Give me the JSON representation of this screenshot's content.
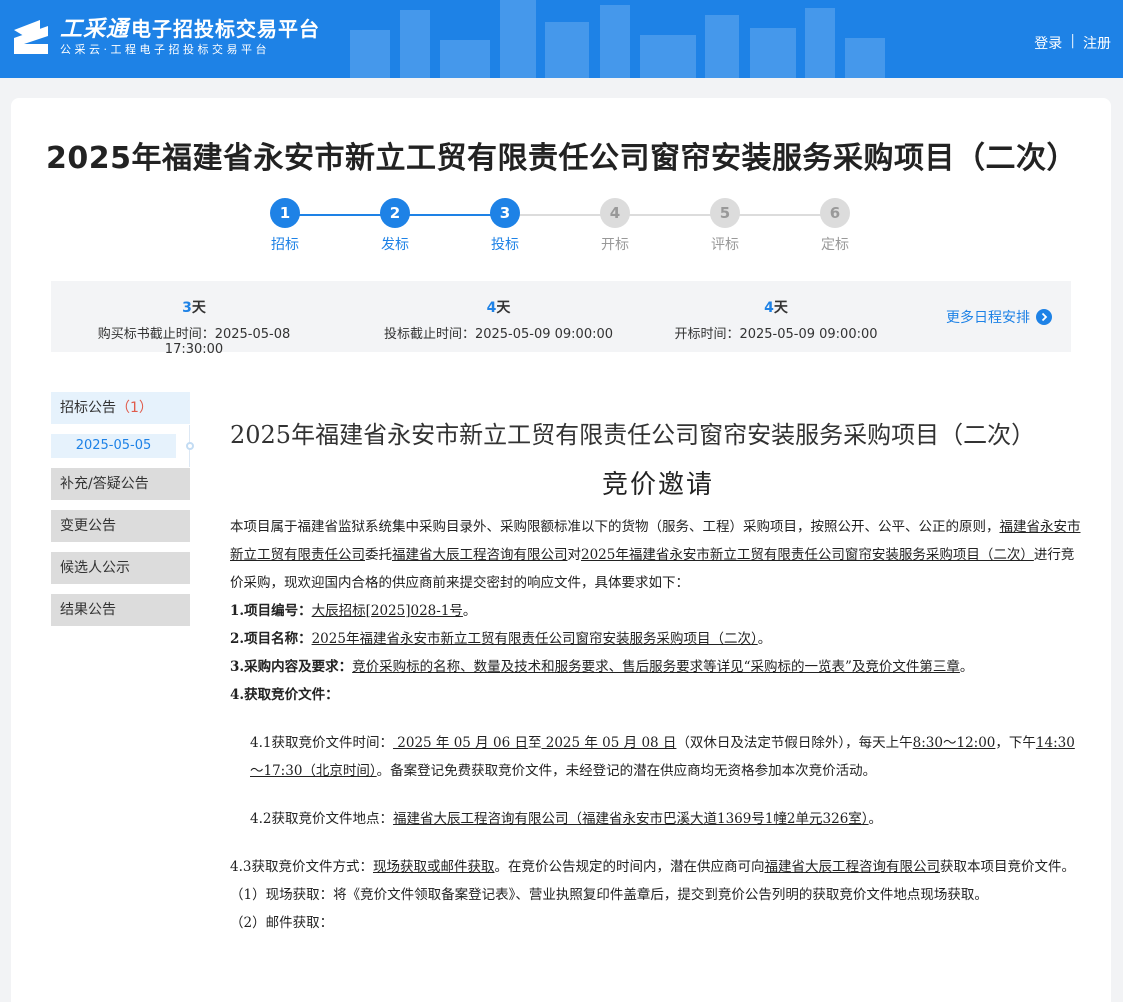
{
  "header": {
    "brand": "工采通",
    "title_rest": "电子招投标交易平台",
    "subtitle": "公采云·工程电子招投标交易平台",
    "login": "登录",
    "register": "注册"
  },
  "project_title": "2025年福建省永安市新立工贸有限责任公司窗帘安装服务采购项目（二次）",
  "steps": [
    {
      "num": "1",
      "label": "招标",
      "state": "active"
    },
    {
      "num": "2",
      "label": "发标",
      "state": "active"
    },
    {
      "num": "3",
      "label": "投标",
      "state": "active"
    },
    {
      "num": "4",
      "label": "开标",
      "state": "inactive"
    },
    {
      "num": "5",
      "label": "评标",
      "state": "inactive"
    },
    {
      "num": "6",
      "label": "定标",
      "state": "inactive"
    }
  ],
  "schedule": {
    "items": [
      {
        "days": "3",
        "unit": "天",
        "text": "购买标书截止时间：2025-05-08 17:30:00"
      },
      {
        "days": "4",
        "unit": "天",
        "text": "投标截止时间：2025-05-09 09:00:00"
      },
      {
        "days": "4",
        "unit": "天",
        "text": "开标时间：2025-05-09 09:00:00"
      }
    ],
    "more": "更多日程安排"
  },
  "sidebar": {
    "items": [
      {
        "label": "招标公告",
        "count": "（1）"
      },
      {
        "label": "补充/答疑公告"
      },
      {
        "label": "变更公告"
      },
      {
        "label": "候选人公示"
      },
      {
        "label": "结果公告"
      }
    ],
    "date": "2025-05-05"
  },
  "doc": {
    "title": "2025年福建省永安市新立工贸有限责任公司窗帘安装服务采购项目（二次）",
    "subtitle": "竞价邀请",
    "intro_a": "本项目属于福建省监狱系统集中采购目录外、采购限额标准以下的货物（服务、工程）采购项目，按照公开、公平、公正的原则，",
    "intro_b": "福建省永安市新立工贸有限责任公司",
    "intro_c": "委托",
    "intro_d": "福建省大辰工程咨询有限公司",
    "intro_e": "对",
    "intro_f": "2025年福建省永安市新立工贸有限责任公司窗帘安装服务采购项目（二次）",
    "intro_g": "进行竞价采购，现欢迎国内合格的供应商前来提交密封的响应文件，具体要求如下：",
    "item1_label": "1.项目编号：",
    "item1_value": "大辰招标[2025]028-1号",
    "item2_label": "2.项目名称：",
    "item2_value": "2025年福建省永安市新立工贸有限责任公司窗帘安装服务采购项目（二次）",
    "item3_label": "3.采购内容及要求：",
    "item3_value": "竞价采购标的名称、数量及技术和服务要求、售后服务要求等详见“采购标的一览表”及竞价文件第三章",
    "item4_label": "4.获取竞价文件：",
    "s41_a": "4.1获取竞价文件时间：",
    "s41_b": " 2025 年 05 月 06 日",
    "s41_c": "至",
    "s41_d": " 2025 年 05 月 08 日",
    "s41_e": "（双休日及法定节假日除外），每天上午",
    "s41_f": "8:30～12:00",
    "s41_g": "，下午",
    "s41_h": "14:30～17:30（北京时间）",
    "s41_i": "。备案登记免费获取竞价文件，未经登记的潜在供应商均无资格参加本次竞价活动。",
    "s42_a": "4.2获取竞价文件地点：",
    "s42_b": "福建省大辰工程咨询有限公司（福建省永安市巴溪大道1369号1幢2单元326室）",
    "s42_c": "。",
    "s43_a": "4.3获取竞价文件方式：",
    "s43_b": "现场获取或邮件获取",
    "s43_c": "。在竞价公告规定的时间内，潜在供应商可向",
    "s43_d": "福建省大辰工程咨询有限公司",
    "s43_e": "获取本项目竞价文件。",
    "onsite": "（1）现场获取：将《竞价文件领取备案登记表》、营业执照复印件盖章后，提交到竞价公告列明的获取竞价文件地点现场获取。",
    "mail": "（2）邮件获取："
  }
}
